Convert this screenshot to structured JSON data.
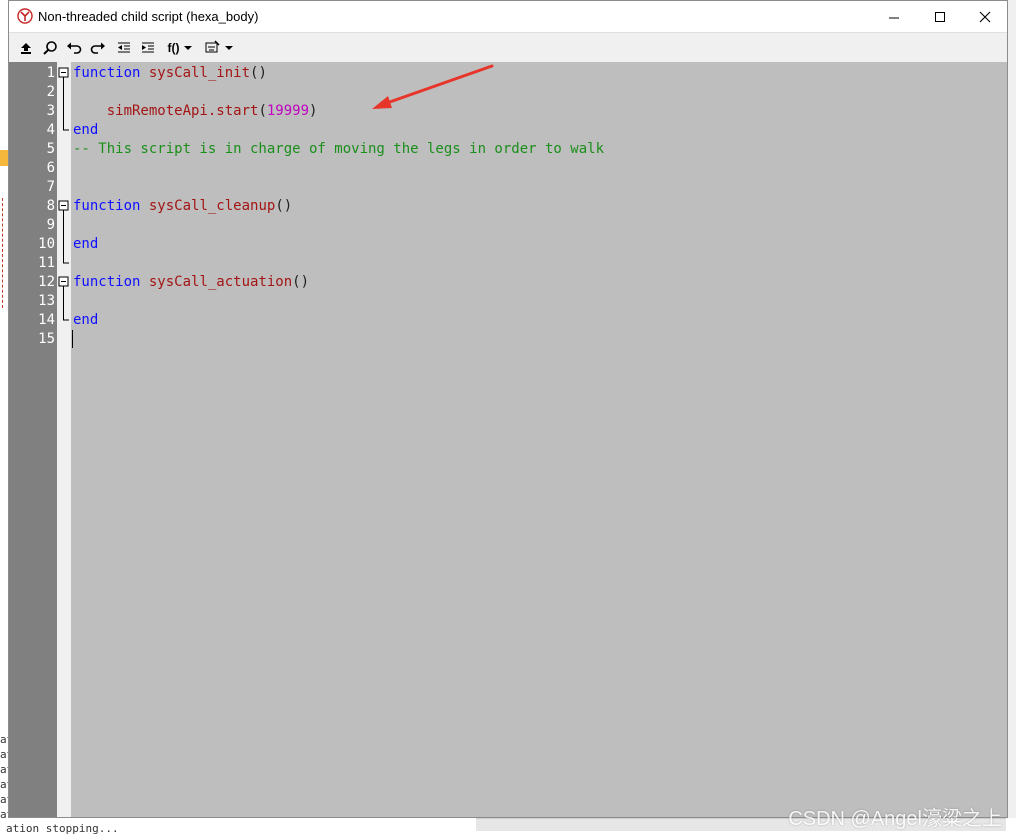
{
  "window": {
    "title": "Non-threaded child script (hexa_body)",
    "controls": {
      "minimize": "minimize",
      "maximize": "maximize",
      "close": "close"
    }
  },
  "toolbar": {
    "function_menu_label": "f()"
  },
  "editor": {
    "lines": [
      {
        "num": "1",
        "tokens": [
          {
            "t": "function",
            "c": "kw"
          },
          {
            "t": " "
          },
          {
            "t": "sysCall_init",
            "c": "fn"
          },
          {
            "t": "()",
            "c": "pu"
          }
        ]
      },
      {
        "num": "2",
        "tokens": []
      },
      {
        "num": "3",
        "tokens": [
          {
            "t": "    "
          },
          {
            "t": "simRemoteApi.start",
            "c": "fn"
          },
          {
            "t": "(",
            "c": "pu"
          },
          {
            "t": "19999",
            "c": "num"
          },
          {
            "t": ")",
            "c": "pu"
          }
        ]
      },
      {
        "num": "4",
        "tokens": [
          {
            "t": "end",
            "c": "kw"
          }
        ]
      },
      {
        "num": "5",
        "tokens": [
          {
            "t": "-- This script is in charge of moving the legs in order to walk",
            "c": "cm"
          }
        ]
      },
      {
        "num": "6",
        "tokens": []
      },
      {
        "num": "7",
        "tokens": []
      },
      {
        "num": "8",
        "tokens": [
          {
            "t": "function",
            "c": "kw"
          },
          {
            "t": " "
          },
          {
            "t": "sysCall_cleanup",
            "c": "fn"
          },
          {
            "t": "()",
            "c": "pu"
          }
        ]
      },
      {
        "num": "9",
        "tokens": []
      },
      {
        "num": "10",
        "tokens": [
          {
            "t": "end",
            "c": "kw"
          }
        ]
      },
      {
        "num": "11",
        "tokens": []
      },
      {
        "num": "12",
        "tokens": [
          {
            "t": "function",
            "c": "kw"
          },
          {
            "t": " "
          },
          {
            "t": "sysCall_actuation",
            "c": "fn"
          },
          {
            "t": "()",
            "c": "pu"
          }
        ]
      },
      {
        "num": "13",
        "tokens": []
      },
      {
        "num": "14",
        "tokens": [
          {
            "t": "end",
            "c": "kw"
          }
        ]
      },
      {
        "num": "15",
        "tokens": []
      }
    ]
  },
  "background": {
    "console_lines": [
      "at",
      "at",
      "at",
      "at",
      "at",
      "at"
    ],
    "console_status": "ation  stopping...",
    "watermark": "CSDN @Angel濠粱之上"
  },
  "colors": {
    "keyword": "#1010ff",
    "identifier": "#a31515",
    "number": "#c000c0",
    "comment": "#1a8f1a",
    "code_bg": "#bebebe",
    "gutter_bg": "#808080",
    "annotation_arrow": "#e8352a"
  },
  "icons": [
    "app-icon",
    "minimize-icon",
    "maximize-icon",
    "close-icon",
    "upload-icon",
    "search-icon",
    "undo-icon",
    "redo-icon",
    "unindent-icon",
    "indent-icon",
    "function-dropdown-icon",
    "insert-snippet-icon",
    "fold-toggle-icon",
    "annotation-arrow-icon"
  ]
}
